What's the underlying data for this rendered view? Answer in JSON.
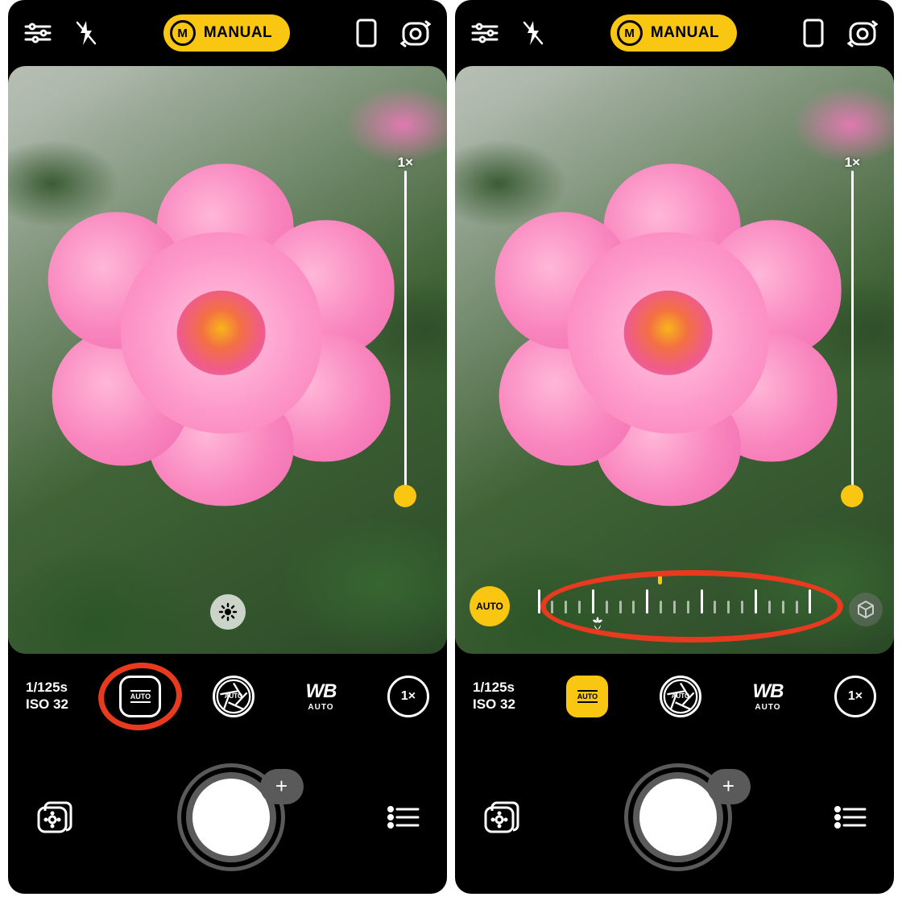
{
  "mode": {
    "badge": "M",
    "label": "MANUAL"
  },
  "zoom": {
    "label": "1×"
  },
  "exposure": {
    "shutter": "1/125s",
    "iso": "ISO 32"
  },
  "controls": {
    "focus_label": "AUTO",
    "aperture_label": "AUTO",
    "wb_label": "WB",
    "wb_sub": "AUTO",
    "zoom_label": "1×"
  },
  "focus_overlay": {
    "auto_label": "AUTO"
  },
  "shutter": {
    "plus": "+"
  }
}
